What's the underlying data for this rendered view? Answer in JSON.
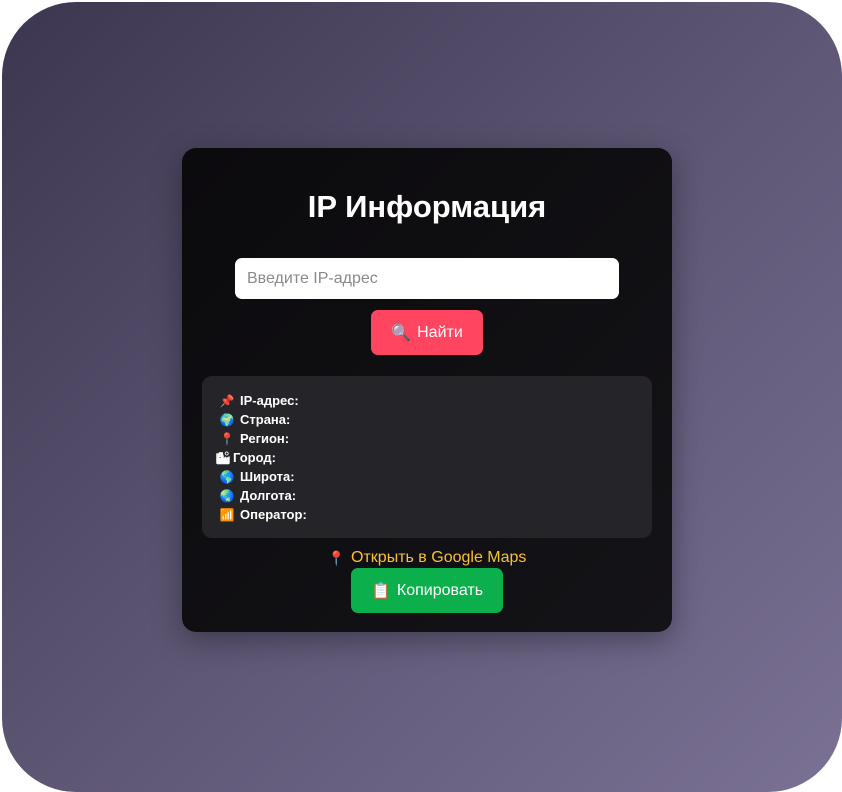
{
  "app": {
    "title": "IP Информация"
  },
  "search": {
    "placeholder": "Введите IP-адрес",
    "value": "",
    "button_icon": "magnifier-icon",
    "button_label": "Найти"
  },
  "results": {
    "rows": [
      {
        "icon": "pushpin-icon",
        "glyph": "📌",
        "label": "IP-адрес:",
        "value": ""
      },
      {
        "icon": "globe-icon",
        "glyph": "🌍",
        "label": "Страна:",
        "value": ""
      },
      {
        "icon": "round-pin-icon",
        "glyph": "📍",
        "label": "Регион:",
        "value": ""
      },
      {
        "icon": "city-icon",
        "glyph": "🏙",
        "label": "Город:",
        "value": ""
      },
      {
        "icon": "globe-icon",
        "glyph": "🌎",
        "label": "Широта:",
        "value": ""
      },
      {
        "icon": "globe-icon",
        "glyph": "🌏",
        "label": "Долгота:",
        "value": ""
      },
      {
        "icon": "antenna-icon",
        "glyph": "📶",
        "label": "Оператор:",
        "value": ""
      }
    ]
  },
  "maps": {
    "icon": "round-pin-icon",
    "glyph": "📍",
    "label": "Открыть в Google Maps"
  },
  "copy": {
    "icon": "clipboard-icon",
    "glyph": "📋",
    "label": "Копировать"
  },
  "colors": {
    "search_button": "#ff4560",
    "copy_button": "#0bb04c",
    "link": "#f9c12e",
    "card": "#0b0a0d",
    "results_panel": "#252428"
  }
}
